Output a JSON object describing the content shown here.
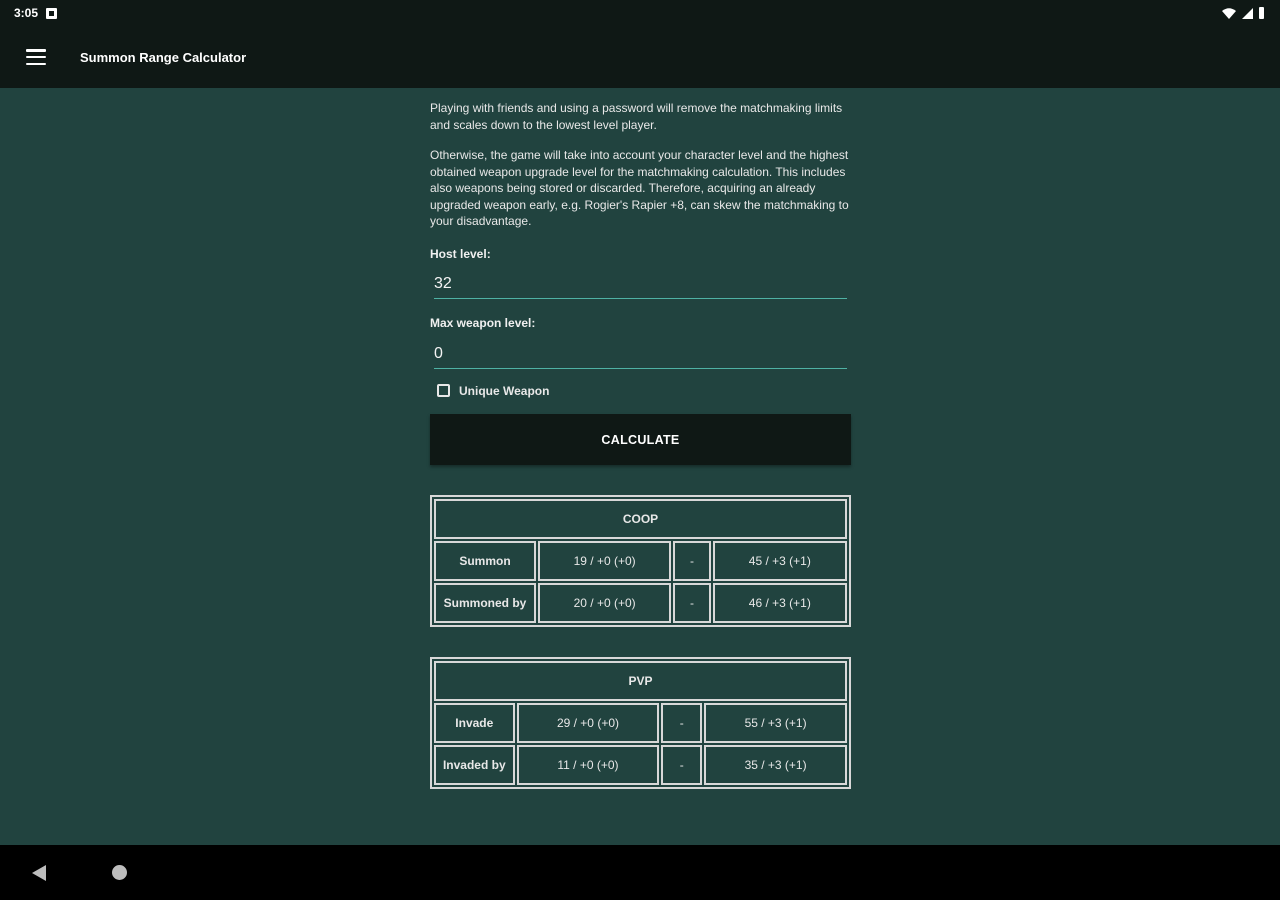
{
  "status_bar": {
    "time": "3:05"
  },
  "app_bar": {
    "title": "Summon Range Calculator",
    "menu_icon": "menu-icon"
  },
  "content": {
    "para1": "Playing with friends and using a password will remove the matchmaking limits and scales down to the lowest level player.",
    "para2": "Otherwise, the game will take into account your character level and the highest obtained weapon upgrade level for the matchmaking calculation. This includes also weapons being stored or discarded. Therefore, acquiring an already upgraded weapon early, e.g. Rogier's Rapier +8, can skew the matchmaking to your disadvantage.",
    "host_level_label": "Host level:",
    "host_level_value": "32",
    "max_weapon_label": "Max weapon level:",
    "max_weapon_value": "0",
    "unique_weapon_label": "Unique Weapon",
    "unique_weapon_checked": false,
    "calculate_label": "CALCULATE"
  },
  "coop": {
    "title": "COOP",
    "rows": [
      {
        "label": "Summon",
        "min": "19 / +0 (+0)",
        "sep": "-",
        "max": "45 / +3 (+1)"
      },
      {
        "label": "Summoned by",
        "min": "20 / +0 (+0)",
        "sep": "-",
        "max": "46 / +3 (+1)"
      }
    ]
  },
  "pvp": {
    "title": "PVP",
    "rows": [
      {
        "label": "Invade",
        "min": "29 / +0 (+0)",
        "sep": "-",
        "max": "55 / +3 (+1)"
      },
      {
        "label": "Invaded by",
        "min": "11 / +0 (+0)",
        "sep": "-",
        "max": "35 / +3 (+1)"
      }
    ]
  },
  "nav_bar": {
    "back_icon": "back-icon",
    "home_icon": "home-icon"
  }
}
